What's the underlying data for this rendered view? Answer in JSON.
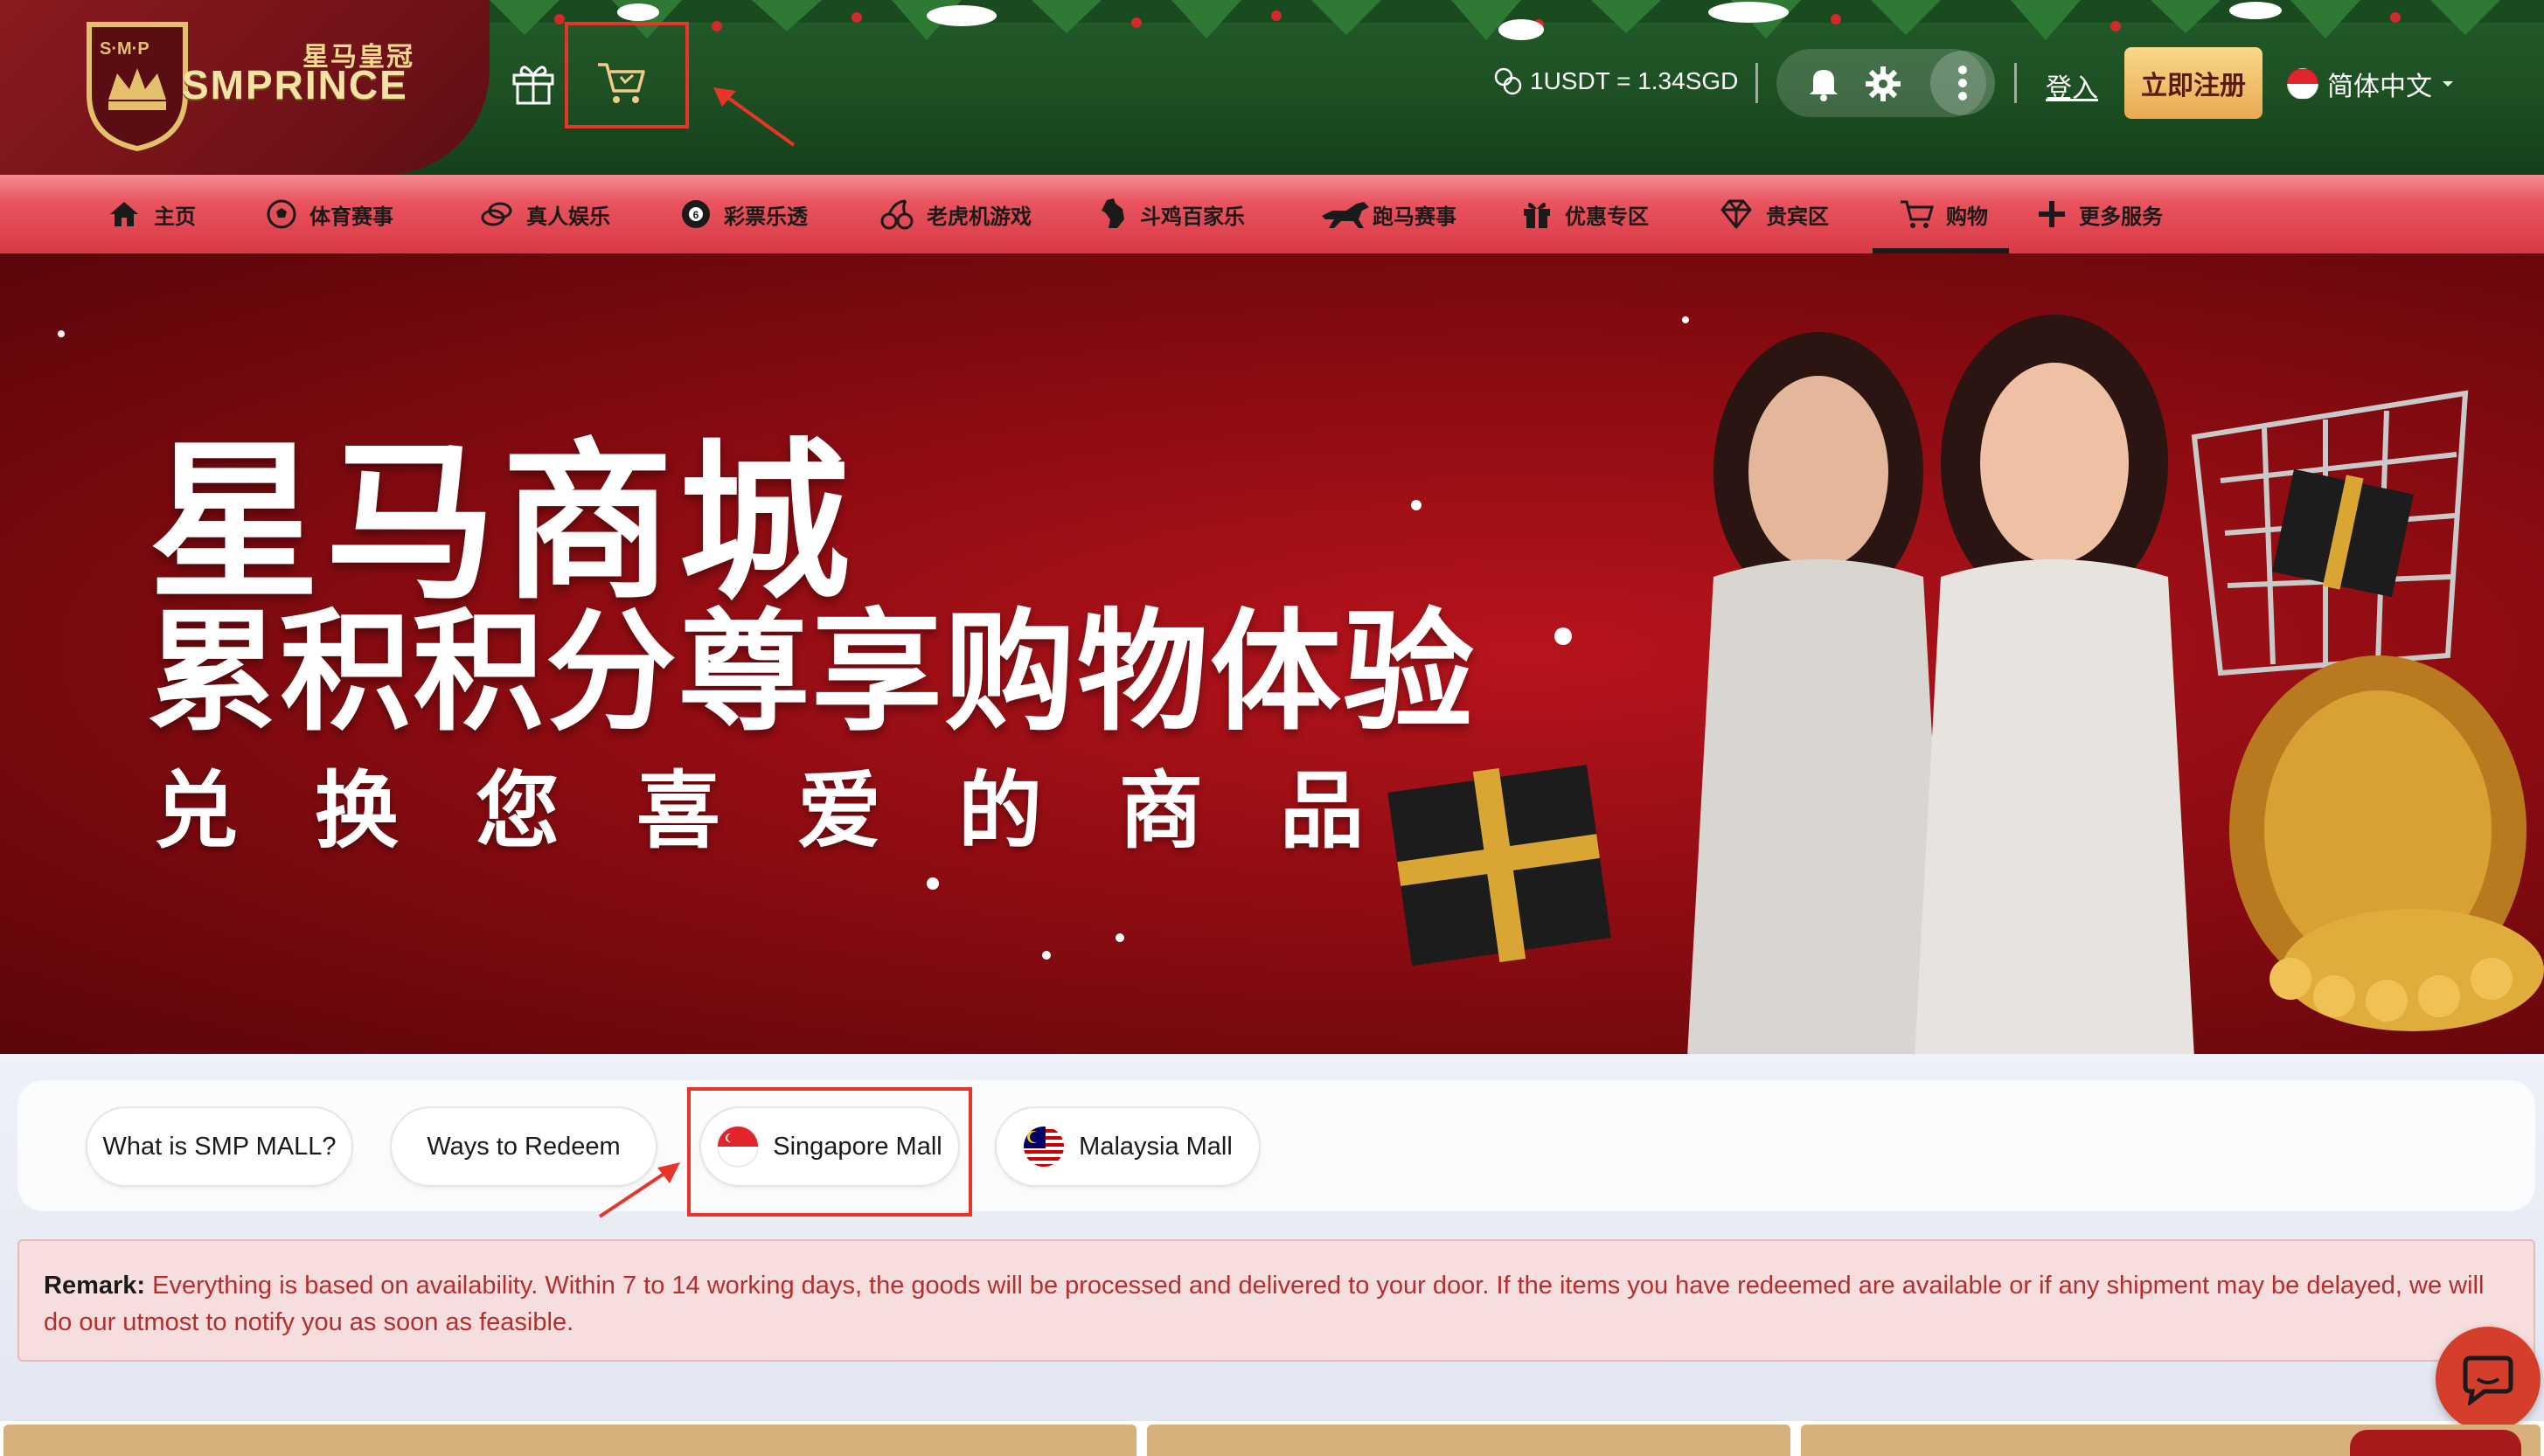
{
  "header": {
    "logo_cn": "星马皇冠",
    "logo_en": "SMPRINCE",
    "exchange_rate": "1USDT = 1.34SGD",
    "login_label": "登入",
    "register_label": "立即注册",
    "language_label": "简体中文"
  },
  "nav": {
    "items": [
      {
        "label": "主页",
        "icon": "home-icon"
      },
      {
        "label": "体育赛事",
        "icon": "soccer-ball-icon"
      },
      {
        "label": "真人娱乐",
        "icon": "chips-icon"
      },
      {
        "label": "彩票乐透",
        "icon": "lottery-ball-icon"
      },
      {
        "label": "老虎机游戏",
        "icon": "cherry-icon"
      },
      {
        "label": "斗鸡百家乐",
        "icon": "rooster-icon"
      },
      {
        "label": "跑马赛事",
        "icon": "horse-icon"
      },
      {
        "label": "优惠专区",
        "icon": "gift-icon"
      },
      {
        "label": "贵宾区",
        "icon": "diamond-icon"
      },
      {
        "label": "购物",
        "icon": "cart-icon"
      },
      {
        "label": "更多服务",
        "icon": "plus-icon"
      }
    ],
    "active": "购物"
  },
  "banner": {
    "title": "星马商城",
    "subtitle": "累积积分尊享购物体验",
    "tagline": "兑换您喜爱的商品"
  },
  "tabs": [
    {
      "label": "What is SMP MALL?"
    },
    {
      "label": "Ways to Redeem"
    },
    {
      "label": "Singapore Mall",
      "flag": "singapore"
    },
    {
      "label": "Malaysia Mall",
      "flag": "malaysia"
    }
  ],
  "remark": {
    "label": "Remark:",
    "text": "Everything is based on availability. Within 7 to 14 working days, the goods will be processed and delivered to your door. If the items you have redeemed are available or if any shipment may be delayed, we will do our utmost to notify you as soon as feasible."
  },
  "colors": {
    "header_green": "#1d4f23",
    "nav_red": "#e9545f",
    "banner_red": "#8e0c12",
    "highlight_red": "#e8352a",
    "remark_text": "#b72d2d"
  }
}
